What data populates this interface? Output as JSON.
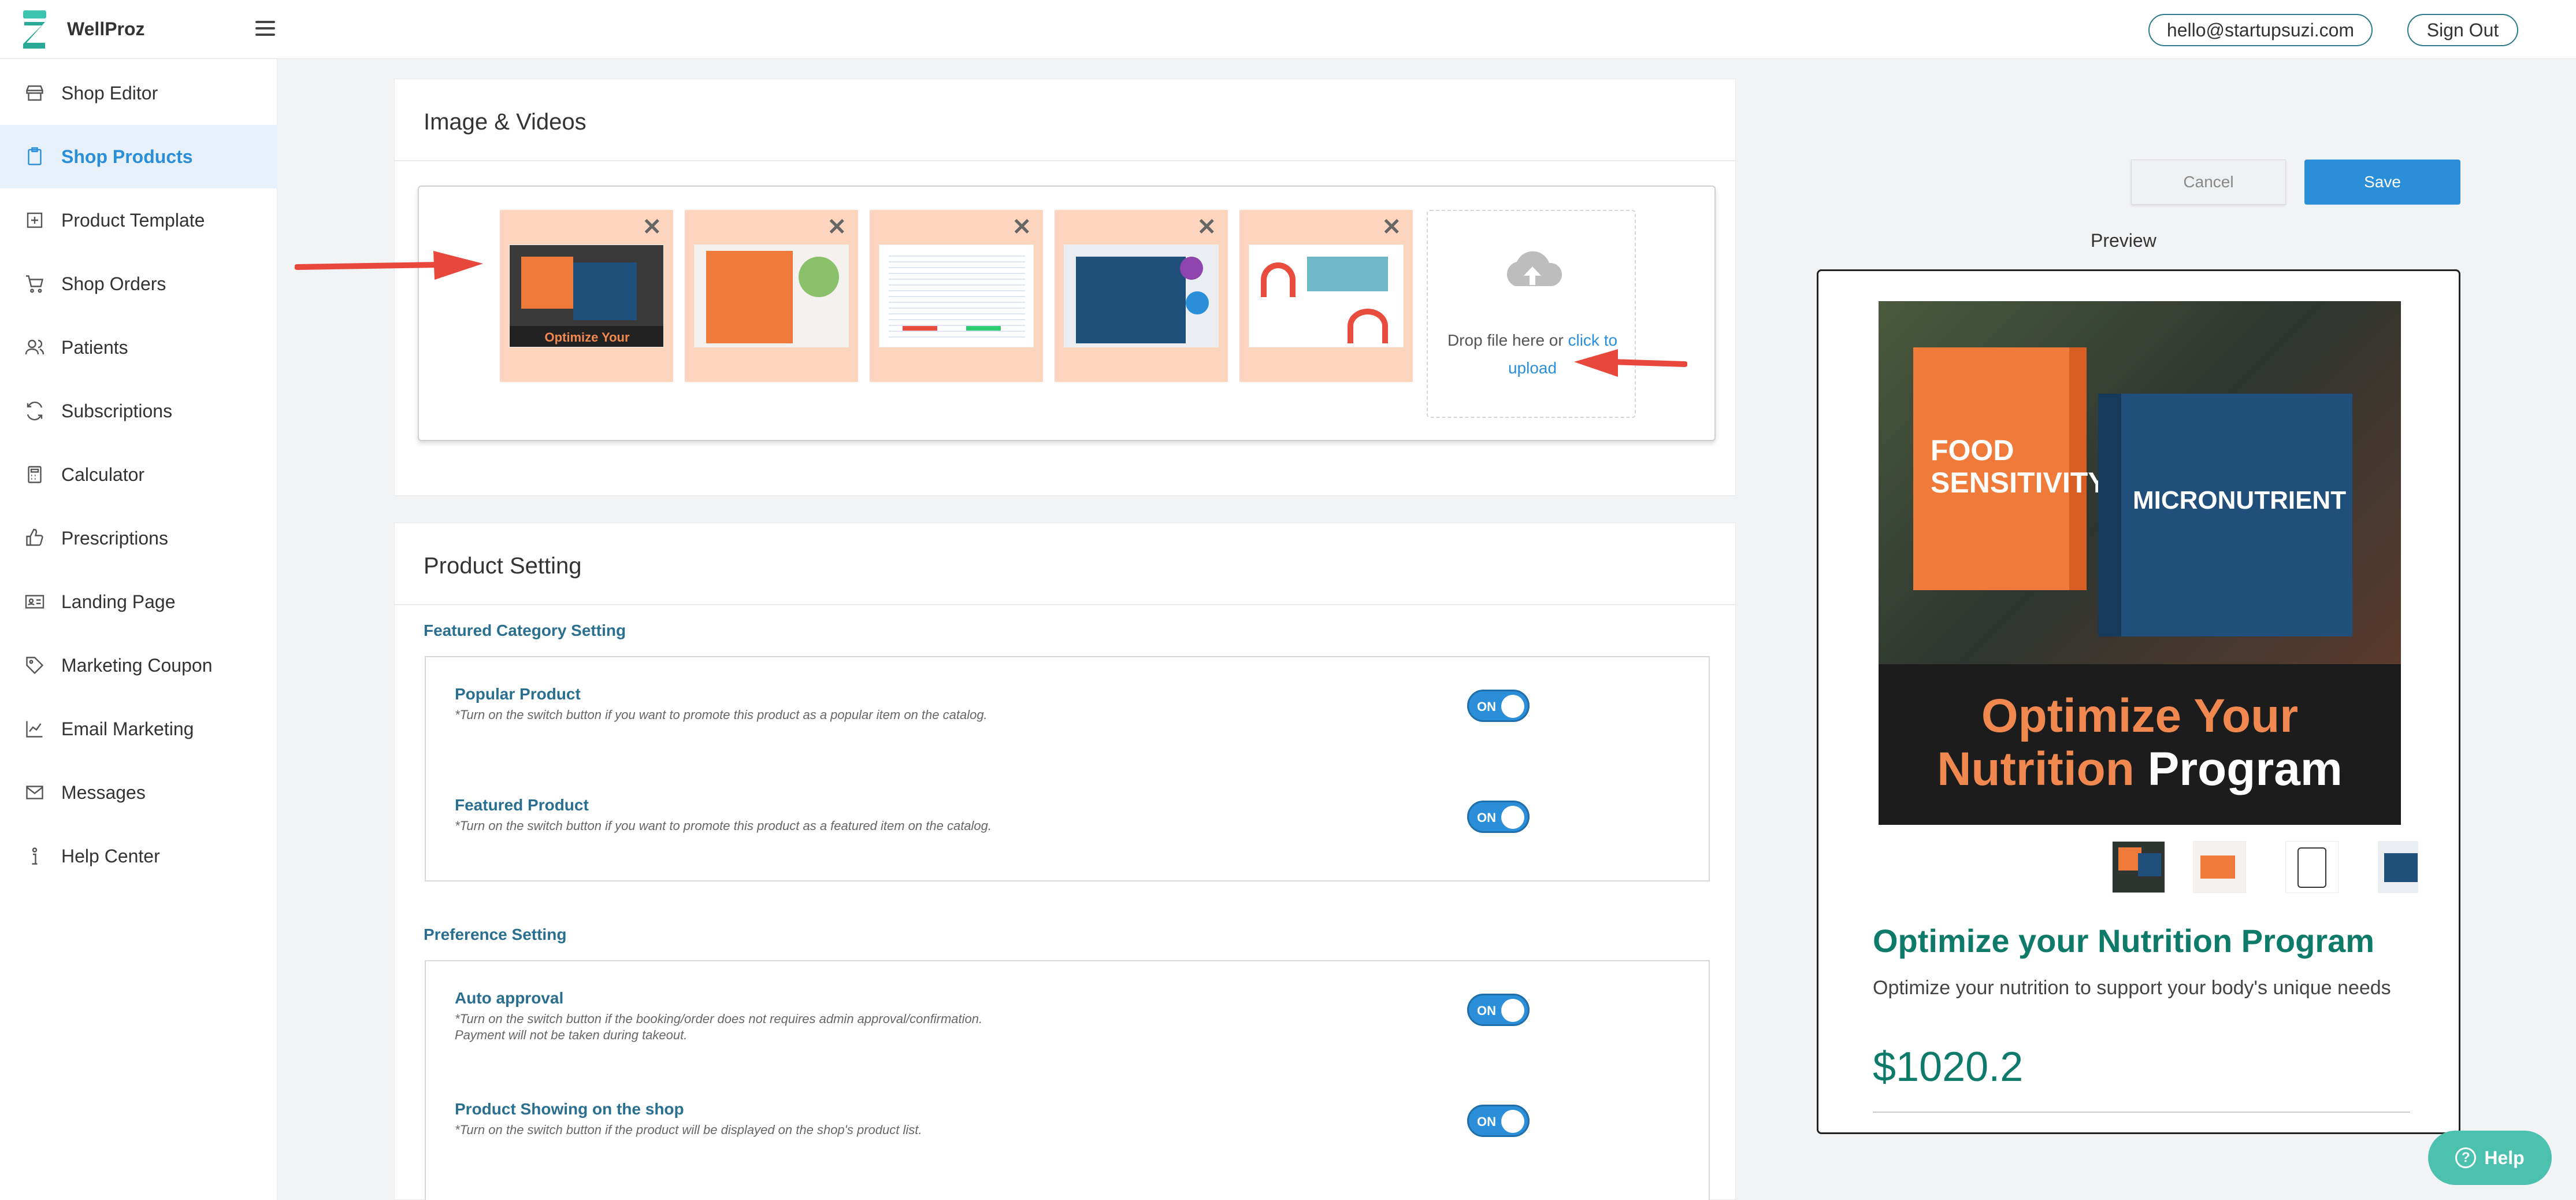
{
  "app": {
    "brand": "WellProz",
    "user_email": "hello@startupsuzi.com",
    "sign_out": "Sign Out"
  },
  "sidebar": {
    "items": [
      {
        "label": "Shop Editor",
        "icon": "store-icon"
      },
      {
        "label": "Shop Products",
        "icon": "clipboard-icon",
        "active": true
      },
      {
        "label": "Product Template",
        "icon": "plus-square-icon"
      },
      {
        "label": "Shop Orders",
        "icon": "cart-icon"
      },
      {
        "label": "Patients",
        "icon": "users-icon"
      },
      {
        "label": "Subscriptions",
        "icon": "refresh-icon"
      },
      {
        "label": "Calculator",
        "icon": "calculator-icon"
      },
      {
        "label": "Prescriptions",
        "icon": "thumbs-up-icon"
      },
      {
        "label": "Landing Page",
        "icon": "id-card-icon"
      },
      {
        "label": "Marketing Coupon",
        "icon": "tag-icon"
      },
      {
        "label": "Email Marketing",
        "icon": "chart-line-icon"
      },
      {
        "label": "Messages",
        "icon": "envelope-icon"
      },
      {
        "label": "Help Center",
        "icon": "info-icon"
      }
    ]
  },
  "media": {
    "header": "Image & Videos",
    "thumb_caption": "Optimize Your",
    "dropzone_text": "Drop file here or",
    "dropzone_link": "click to upload"
  },
  "product_setting": {
    "header": "Product Setting",
    "featured_section": "Featured Category Setting",
    "preference_section": "Preference Setting",
    "settings": [
      {
        "title": "Popular Product",
        "desc": "*Turn on the switch button if you want to promote this product as a popular item on the catalog.",
        "state": "ON"
      },
      {
        "title": "Featured Product",
        "desc": "*Turn on the switch button if you want to promote this product as a featured item on the catalog.",
        "state": "ON"
      },
      {
        "title": "Auto approval",
        "desc": "*Turn on the switch button if the booking/order does not requires admin approval/confirmation.",
        "desc2": "Payment will not be taken during takeout.",
        "state": "ON"
      },
      {
        "title": "Product Showing on the shop",
        "desc": "*Turn on the switch button if the product will be displayed on the shop's product list.",
        "state": "ON"
      }
    ]
  },
  "actions": {
    "cancel": "Cancel",
    "save": "Save"
  },
  "preview": {
    "label": "Preview",
    "image_caption_orange": "Optimize Your",
    "image_caption_orange2": "Nutrition",
    "image_caption_white": "Program",
    "box1_text": "FOOD SENSITIVITY",
    "box2_text": "MICRONUTRIENT",
    "title": "Optimize your Nutrition Program",
    "description": "Optimize your nutrition to support your body's unique needs",
    "price": "$1020.2"
  },
  "help": {
    "label": "Help"
  },
  "colors": {
    "accent": "#2a8fd8",
    "brand_teal": "#0e7a6a",
    "arrow_red": "#e8473b",
    "thumb_bg": "#fdd4bd"
  }
}
